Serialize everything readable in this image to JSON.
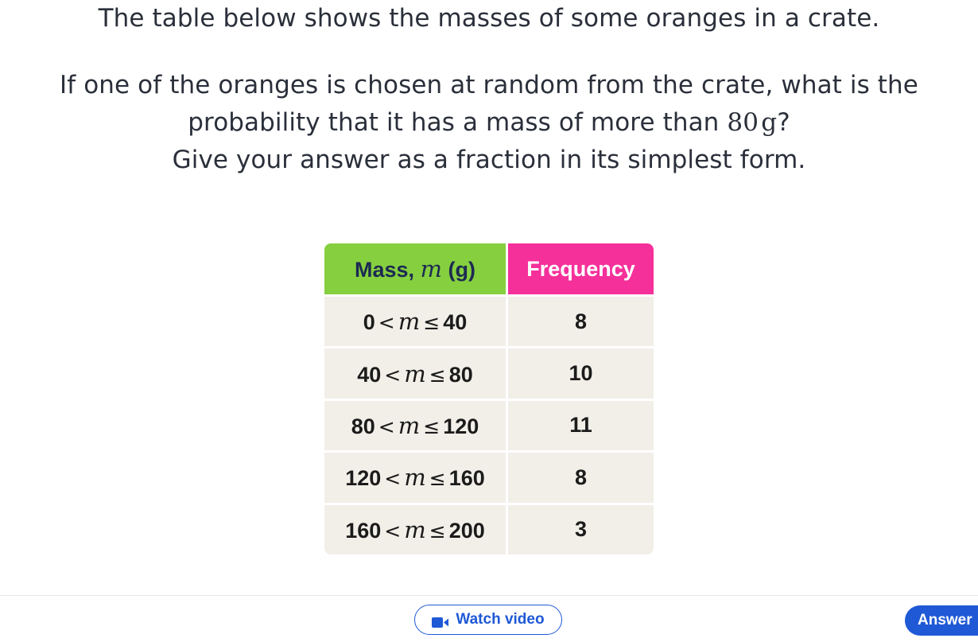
{
  "question": {
    "intro": "The table below shows the masses of some oranges in a crate.",
    "line1": "If one of the oranges is chosen at random from the crate, what is the",
    "line2_pre": "probability that it has a mass of more than ",
    "line2_value": "80",
    "line2_unit": "g",
    "line2_post": "?",
    "line3": "Give your answer as a fraction in its simplest form."
  },
  "table": {
    "header_mass_pre": "Mass, ",
    "header_mass_var": "m",
    "header_mass_post": " (g)",
    "header_frequency": "Frequency",
    "variable": "m",
    "lt": "<",
    "le": "≤",
    "rows": [
      {
        "lower": "0",
        "upper": "40",
        "frequency": "8"
      },
      {
        "lower": "40",
        "upper": "80",
        "frequency": "10"
      },
      {
        "lower": "80",
        "upper": "120",
        "frequency": "11"
      },
      {
        "lower": "120",
        "upper": "160",
        "frequency": "8"
      },
      {
        "lower": "160",
        "upper": "200",
        "frequency": "3"
      }
    ]
  },
  "footer": {
    "watch_video_label": "Watch video",
    "watch_video_icon": "video-camera-icon",
    "answer_label": "Answer",
    "accent_color": "#1f59d6"
  },
  "colors": {
    "mass_header": "#86d03f",
    "frequency_header": "#f5309a",
    "cell_background": "#f2efe8"
  }
}
